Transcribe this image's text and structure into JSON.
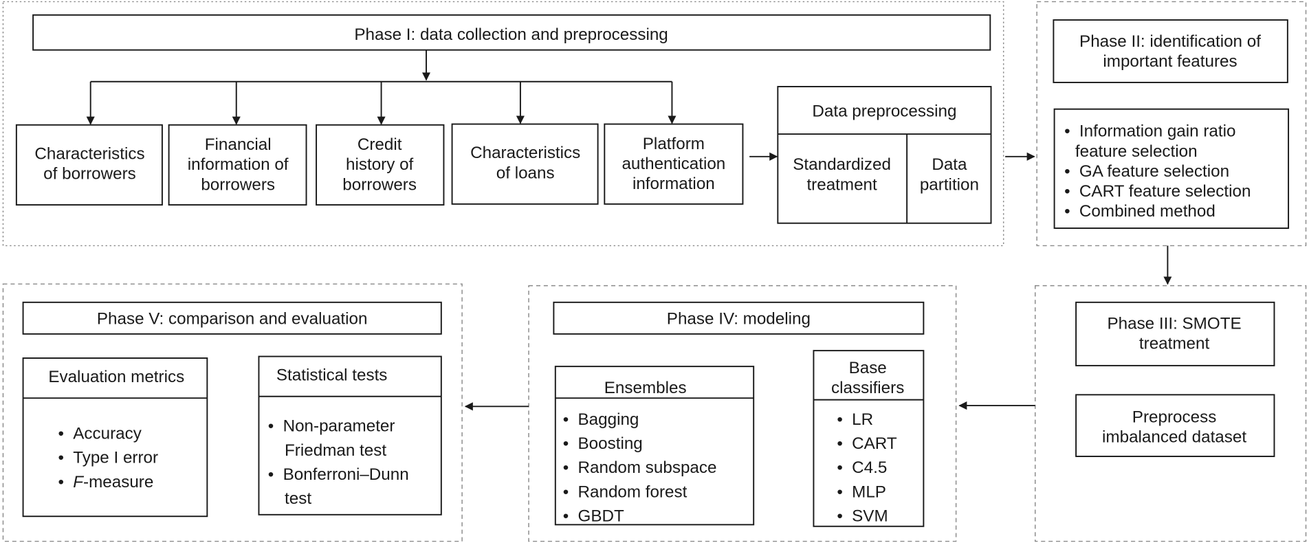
{
  "phase1": {
    "title": "Phase I: data collection and preprocessing",
    "sources": [
      [
        "Characteristics",
        "of borrowers"
      ],
      [
        "Financial",
        "information of",
        "borrowers"
      ],
      [
        "Credit",
        "history of",
        "borrowers"
      ],
      [
        "Characteristics",
        "of loans"
      ],
      [
        "Platform",
        "authentication",
        "information"
      ]
    ],
    "preprocessing": {
      "title": "Data preprocessing",
      "left": [
        "Standardized",
        "treatment"
      ],
      "right": [
        "Data",
        "partition"
      ]
    }
  },
  "phase2": {
    "title": [
      "Phase II: identification of",
      "important features"
    ],
    "items": [
      "Information gain ratio",
      "feature selection",
      "GA feature selection",
      "CART feature selection",
      "Combined method"
    ]
  },
  "phase3": {
    "title": [
      "Phase III: SMOTE",
      "treatment"
    ],
    "body": [
      "Preprocess",
      "imbalanced dataset"
    ]
  },
  "phase4": {
    "title": "Phase IV: modeling",
    "ensembles": {
      "title": "Ensembles",
      "items": [
        "Bagging",
        "Boosting",
        "Random subspace",
        "Random forest",
        "GBDT"
      ]
    },
    "base": {
      "title": [
        "Base",
        "classifiers"
      ],
      "items": [
        "LR",
        "CART",
        "C4.5",
        "MLP",
        "SVM"
      ]
    }
  },
  "phase5": {
    "title": "Phase V: comparison and evaluation",
    "metrics": {
      "title": "Evaluation metrics",
      "items": [
        "Accuracy",
        "Type I error",
        "F",
        "-measure"
      ]
    },
    "tests": {
      "title": "Statistical tests",
      "items": [
        "Non-parameter",
        "Friedman test",
        "Bonferroni–Dunn",
        "test"
      ]
    }
  },
  "bullet": "•"
}
